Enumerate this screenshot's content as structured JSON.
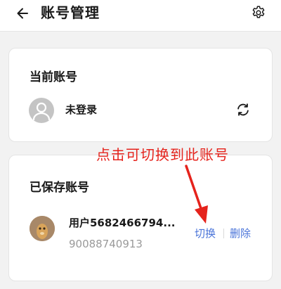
{
  "header": {
    "title": "账号管理"
  },
  "current_account": {
    "section_title": "当前账号",
    "status": "未登录"
  },
  "saved_accounts": {
    "section_title": "已保存账号",
    "items": [
      {
        "username": "用户5682466794...",
        "user_id": "90088740913",
        "switch_label": "切换",
        "delete_label": "删除"
      }
    ]
  },
  "annotation": {
    "text": "点击可切换到此账号"
  },
  "colors": {
    "link": "#4a74d9",
    "annotation": "#e5231c",
    "background": "#f2f2f2"
  },
  "icons": [
    "back-arrow-icon",
    "settings-gear-icon",
    "default-avatar-icon",
    "refresh-icon",
    "user-avatar"
  ]
}
